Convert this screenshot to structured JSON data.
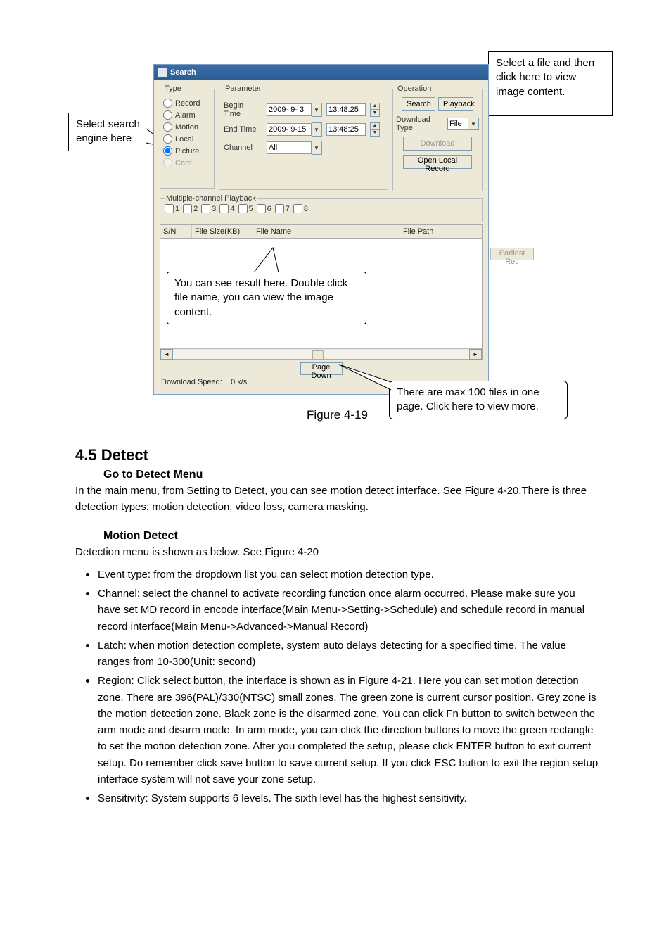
{
  "callouts": {
    "c1": {
      "l1": "Select search",
      "l2": "engine here"
    },
    "c2": {
      "l1": "Select a file and then",
      "l2": "click here to view",
      "l3": "image content."
    },
    "c3": {
      "l1": "You can see result here. Double click",
      "l2": "file name, you can view the image",
      "l3": "content."
    },
    "c4": {
      "l1": "There are max 100 files in one",
      "l2": "page. Click here to view more."
    }
  },
  "appwin": {
    "title": "Search",
    "type_legend": "Type",
    "types": {
      "record": "Record",
      "alarm": "Alarm",
      "motion": "Motion",
      "local": "Local",
      "picture": "Picture",
      "card": "Card"
    },
    "param_legend": "Parameter",
    "begin_label": "Begin Time",
    "end_label": "End Time",
    "channel_label": "Channel",
    "begin_date": "2009- 9- 3",
    "end_date": "2009- 9-15",
    "time1": "13:48:25",
    "time2": "13:48:25",
    "channel_value": "All",
    "earliest": "Earliest Rec",
    "op_legend": "Operation",
    "search_btn": "Search",
    "playback_btn": "Playback",
    "dl_type_label": "Download Type",
    "dl_type_value": "File",
    "download_btn": "Download",
    "open_local_btn": "Open Local Record",
    "mcp_legend": "Multiple-channel Playback",
    "mcp": [
      "1",
      "2",
      "3",
      "4",
      "5",
      "6",
      "7",
      "8"
    ],
    "cols": {
      "sn": "S/N",
      "fs": "File Size(KB)",
      "fn": "File Name",
      "fp": "File Path"
    },
    "pagedown": "Page Down",
    "dls_label": "Download Speed:",
    "dls_value": "0 k/s"
  },
  "figcap": "Figure 4-19",
  "section": "4.5  Detect",
  "go_menu_h": "Go to Detect Menu",
  "go_menu_p": "In the main menu, from Setting to Detect, you can see motion detect interface. See Figure 4-20.There is three detection types: motion detection, video loss, camera masking.",
  "motion_h": "Motion Detect",
  "motion_p": "Detection menu is shown as below. See Figure 4-20",
  "bullets": {
    "b1": "Event type: from the dropdown list you can select motion detection type.",
    "b2": "Channel: select the channel to activate recording function once alarm occurred. Please make sure you have set MD record in encode interface(Main Menu->Setting->Schedule) and schedule record in manual record interface(Main Menu->Advanced->Manual Record)",
    "b3": "Latch: when motion detection complete, system auto delays detecting for a specified time. The value ranges from 10-300(Unit: second)",
    "b4": "Region: Click select button, the interface is shown as in Figure 4-21.  Here you can set motion detection zone. There are 396(PAL)/330(NTSC) small zones. The green zone is current cursor position. Grey zone is the motion detection zone. Black zone is the disarmed zone. You can click Fn button to switch between the arm mode and disarm mode.  In arm mode, you can click the direction buttons to move the green rectangle to set the motion detection zone. After you completed the setup, please click ENTER button to exit current setup. Do remember click save button to save current setup. If you click ESC button to exit the region setup interface system will not save your zone setup.",
    "b5": "Sensitivity: System supports 6 levels. The sixth level has the highest sensitivity."
  }
}
